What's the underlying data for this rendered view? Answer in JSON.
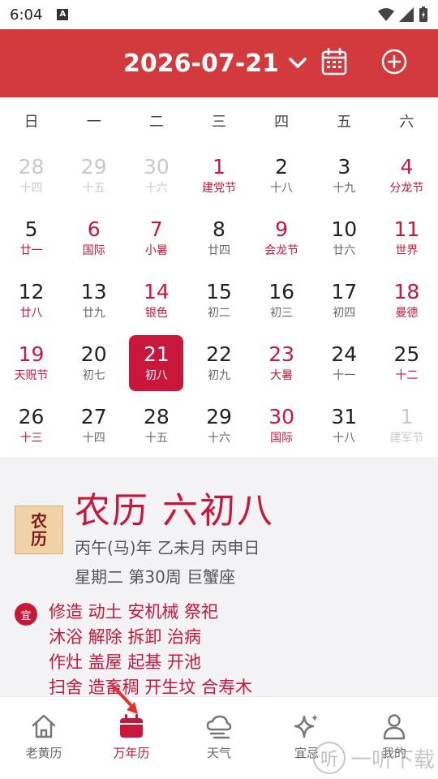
{
  "status": {
    "time": "6:04",
    "a_badge": "A"
  },
  "header": {
    "date": "2026-07-21"
  },
  "weekdays": [
    "日",
    "一",
    "二",
    "三",
    "四",
    "五",
    "六"
  ],
  "rows": [
    [
      {
        "num": "28",
        "sub": "十四",
        "other": true
      },
      {
        "num": "29",
        "sub": "十五",
        "other": true
      },
      {
        "num": "30",
        "sub": "十六",
        "other": true
      },
      {
        "num": "1",
        "sub": "建党节",
        "weekend": true,
        "festival": true
      },
      {
        "num": "2",
        "sub": "十八"
      },
      {
        "num": "3",
        "sub": "十九"
      },
      {
        "num": "4",
        "sub": "分龙节",
        "weekend": true,
        "festival": true
      }
    ],
    [
      {
        "num": "5",
        "sub": "廿一",
        "festival": true
      },
      {
        "num": "6",
        "sub": "国际",
        "weekend": true,
        "festival": true
      },
      {
        "num": "7",
        "sub": "小暑",
        "weekend": true,
        "festival": true
      },
      {
        "num": "8",
        "sub": "廿四"
      },
      {
        "num": "9",
        "sub": "会龙节",
        "weekend": true,
        "festival": true
      },
      {
        "num": "10",
        "sub": "廿六"
      },
      {
        "num": "11",
        "sub": "世界",
        "weekend": true,
        "festival": true
      }
    ],
    [
      {
        "num": "12",
        "sub": "廿八",
        "festival": true
      },
      {
        "num": "13",
        "sub": "廿九"
      },
      {
        "num": "14",
        "sub": "银色",
        "weekend": true,
        "festival": true
      },
      {
        "num": "15",
        "sub": "初二"
      },
      {
        "num": "16",
        "sub": "初三"
      },
      {
        "num": "17",
        "sub": "初四"
      },
      {
        "num": "18",
        "sub": "曼德",
        "weekend": true,
        "festival": true
      }
    ],
    [
      {
        "num": "19",
        "sub": "天贶节",
        "weekend": true,
        "festival": true
      },
      {
        "num": "20",
        "sub": "初七"
      },
      {
        "num": "21",
        "sub": "初八",
        "selected": true
      },
      {
        "num": "22",
        "sub": "初九"
      },
      {
        "num": "23",
        "sub": "大暑",
        "weekend": true,
        "festival": true
      },
      {
        "num": "24",
        "sub": "十一"
      },
      {
        "num": "25",
        "sub": "十二",
        "festival": true
      }
    ],
    [
      {
        "num": "26",
        "sub": "十三",
        "festival": true
      },
      {
        "num": "27",
        "sub": "十四"
      },
      {
        "num": "28",
        "sub": "十五"
      },
      {
        "num": "29",
        "sub": "十六"
      },
      {
        "num": "30",
        "sub": "国际",
        "weekend": true,
        "festival": true
      },
      {
        "num": "31",
        "sub": "十八"
      },
      {
        "num": "1",
        "sub": "建军节",
        "other": true
      }
    ]
  ],
  "detail": {
    "lunar_title": "农历 六初八",
    "logo_top": "农",
    "logo_bottom": "历",
    "line1": "丙午(马)年 乙未月 丙申日",
    "line2": "星期二 第30周 巨蟹座",
    "yi_badge": "宜",
    "yi_lines": [
      "修造 动土 安机械 祭祀",
      "沐浴 解除 拆卸 治病",
      "作灶 盖屋 起基 开池",
      "扫舍 造畜稠 开生坟 合寿木"
    ]
  },
  "tabs": [
    {
      "label": "老黄历",
      "icon": "house-icon"
    },
    {
      "label": "万年历",
      "icon": "calendar-icon",
      "active": true
    },
    {
      "label": "天气",
      "icon": "cloud-icon"
    },
    {
      "label": "宜忌",
      "icon": "sparkle-icon"
    },
    {
      "label": "我的",
      "icon": "person-icon"
    }
  ],
  "watermark": {
    "logo_char": "听",
    "text": "一听下载"
  },
  "colors": {
    "header_red": "#d23a3e",
    "accent_red": "#c8173a"
  }
}
